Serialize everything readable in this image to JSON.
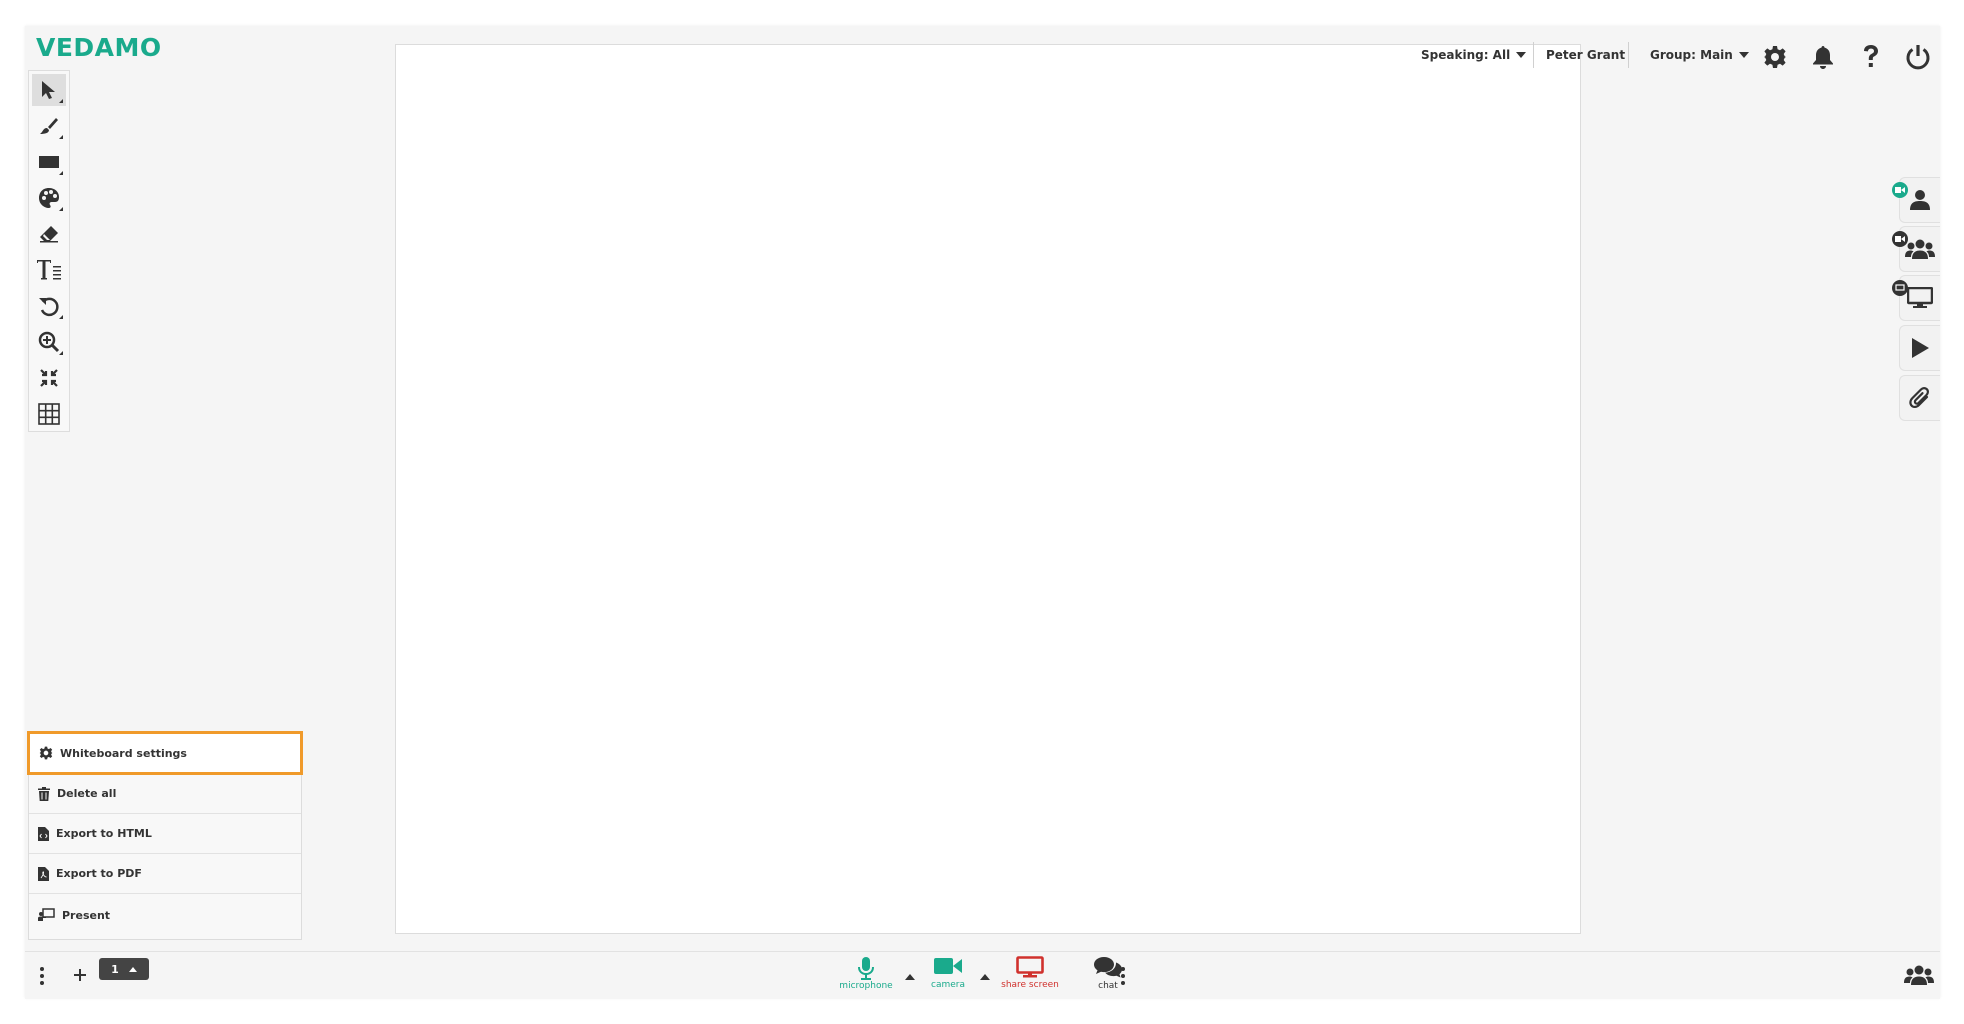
{
  "app": {
    "logo": "VEDAMO",
    "brand_color": "#1aaa8c"
  },
  "toolbar": {
    "tools": [
      {
        "name": "select",
        "icon": "pointer-icon",
        "active": true
      },
      {
        "name": "pen",
        "icon": "brush-icon"
      },
      {
        "name": "shapes",
        "icon": "rectangle-icon"
      },
      {
        "name": "colors",
        "icon": "palette-icon"
      },
      {
        "name": "eraser",
        "icon": "eraser-icon"
      },
      {
        "name": "text",
        "icon": "text-icon"
      },
      {
        "name": "undo",
        "icon": "undo-icon"
      },
      {
        "name": "zoom",
        "icon": "zoom-in-icon"
      },
      {
        "name": "fit",
        "icon": "compress-icon"
      },
      {
        "name": "grid",
        "icon": "grid-icon"
      }
    ]
  },
  "header": {
    "speaking_label": "Speaking: All",
    "user_name": "Peter Grant",
    "group_label": "Group: Main",
    "icons": [
      "gear-icon",
      "bell-icon",
      "help-icon",
      "power-icon"
    ]
  },
  "right_rail": {
    "items": [
      "user-icon",
      "users-group-icon",
      "monitor-icon",
      "play-icon",
      "paperclip-icon"
    ],
    "badge_active_color": "#1aaa8c"
  },
  "whiteboard_menu": {
    "items": [
      {
        "label": "Whiteboard settings",
        "icon": "gear-icon",
        "highlighted": true
      },
      {
        "label": "Delete all",
        "icon": "trash-icon"
      },
      {
        "label": "Export to HTML",
        "icon": "file-code-icon"
      },
      {
        "label": "Export to PDF",
        "icon": "file-pdf-icon"
      },
      {
        "label": "Present",
        "icon": "present-icon"
      }
    ],
    "highlight_color": "#f09a2a"
  },
  "bottom_bar": {
    "page_number": "1",
    "microphone_label": "microphone",
    "camera_label": "camera",
    "share_screen_label": "share screen",
    "chat_label": "chat",
    "mic_color": "#1aaa8c",
    "camera_color": "#1aaa8c",
    "share_color": "#d0312d"
  }
}
